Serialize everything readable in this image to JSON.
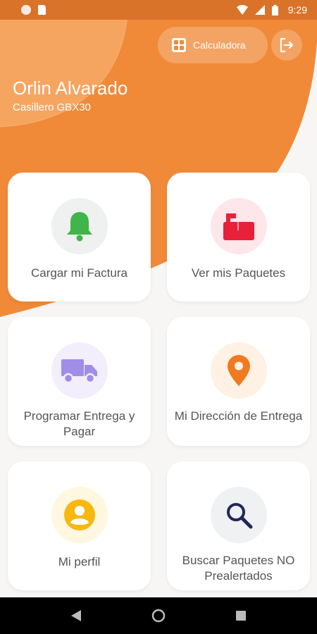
{
  "status_bar": {
    "time": "9:29"
  },
  "header": {
    "calculator_label": "Calculadora",
    "user_name": "Orlin Alvarado",
    "locker": "Casillero GBX30"
  },
  "colors": {
    "brand_orange": "#f08a38",
    "status_bar": "#d9732a"
  },
  "cards": [
    {
      "label": "Cargar mi Factura",
      "icon": "bell-icon",
      "icon_color": "#3fb54a",
      "bg": "#eef1ef"
    },
    {
      "label": "Ver mis Paquetes",
      "icon": "mailbox-icon",
      "icon_color": "#e8203a",
      "bg": "#fde7ea"
    },
    {
      "label": "Programar Entrega y Pagar",
      "icon": "truck-icon",
      "icon_color": "#9e8ee8",
      "bg": "#f2eefc"
    },
    {
      "label": "Mi Dirección de Entrega",
      "icon": "location-pin-icon",
      "icon_color": "#f07a22",
      "bg": "#fff1e4"
    },
    {
      "label": "Mi perfil",
      "icon": "user-profile-icon",
      "icon_color": "#f7b80f",
      "bg": "#fff7e0"
    },
    {
      "label": "Buscar Paquetes NO Prealertados",
      "icon": "search-icon",
      "icon_color": "#1f2858",
      "bg": "#eff1f3"
    }
  ]
}
